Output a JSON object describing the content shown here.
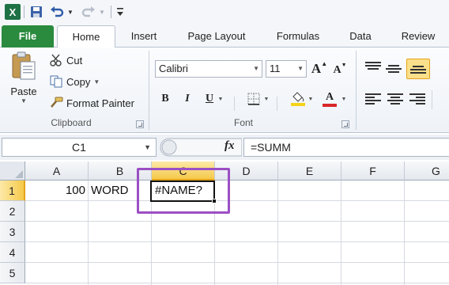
{
  "qat": {
    "app_icon": "excel-icon",
    "save_icon": "save-icon",
    "undo_icon": "undo-icon",
    "redo_icon": "redo-icon",
    "customize_icon": "customize-qat-icon"
  },
  "tabs": [
    {
      "label": "File"
    },
    {
      "label": "Home"
    },
    {
      "label": "Insert"
    },
    {
      "label": "Page Layout"
    },
    {
      "label": "Formulas"
    },
    {
      "label": "Data"
    },
    {
      "label": "Review"
    }
  ],
  "clipboard": {
    "paste_label": "Paste",
    "cut_label": "Cut",
    "copy_label": "Copy",
    "format_painter_label": "Format Painter",
    "group_label": "Clipboard"
  },
  "font": {
    "font_name": "Calibri",
    "font_size": "11",
    "grow_label": "A",
    "shrink_label": "A",
    "bold_label": "B",
    "italic_label": "I",
    "underline_label": "U",
    "font_color_label": "A",
    "group_label": "Font"
  },
  "formula_bar": {
    "name_box": "C1",
    "fx_label": "fx",
    "formula": "=SUMM"
  },
  "grid": {
    "columns": [
      "A",
      "B",
      "C",
      "D",
      "E",
      "F",
      "G"
    ],
    "rows": [
      "1",
      "2",
      "3",
      "4",
      "5"
    ],
    "active_column": "C",
    "active_row": "1",
    "cells": {
      "A1": "100",
      "B1": "WORD",
      "C1": "#NAME?"
    }
  },
  "colors": {
    "file_tab": "#2a8a3e",
    "selection_highlight": "#9b4fc4",
    "active_header": "#f5c94a",
    "font_color_bar": "#d8262a",
    "fill_color_bar": "#f5d31a"
  }
}
